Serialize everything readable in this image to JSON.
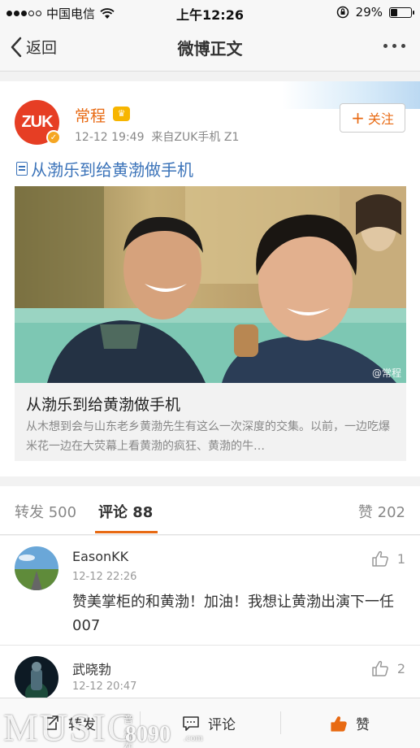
{
  "status_bar": {
    "carrier": "中国电信",
    "time": "上午12:26",
    "battery": "29%",
    "battery_level": 0.29
  },
  "nav": {
    "back_label": "返回",
    "title": "微博正文"
  },
  "post": {
    "user_name": "常程",
    "avatar_text": "ZUK",
    "timestamp": "12-12 19:49",
    "source": "来自ZUK手机 Z1",
    "follow_label": "关注",
    "link_title": "从渤乐到给黄渤做手机",
    "article": {
      "title": "从渤乐到给黄渤做手机",
      "description": "从木想到会与山东老乡黄渤先生有这么一次深度的交集。以前，一边吃爆米花一边在大荧幕上看黄渤的疯狂、黄渤的牛…",
      "photo_watermark": "@常程"
    }
  },
  "tabs": [
    {
      "label": "转发 500"
    },
    {
      "label": "评论 88"
    },
    {
      "label": "赞 202"
    }
  ],
  "comments": [
    {
      "name": "EasonKK",
      "time": "12-12 22:26",
      "text": "赞美掌柜的和黄渤！加油！我想让黄渤出演下一任007",
      "likes": "1"
    },
    {
      "name": "武晓勃",
      "time": "12-12 20:47",
      "likes": "2"
    }
  ],
  "toolbar": {
    "repost_label": "转发",
    "comment_label": "评论",
    "like_label": "赞"
  },
  "watermark": {
    "brand": "MUSIC",
    "small": "音乐在线",
    "number": "8090",
    "domain": ".com"
  },
  "colors": {
    "accent": "#e86a13",
    "link": "#3b73b9",
    "brand_red": "#e63e24"
  }
}
